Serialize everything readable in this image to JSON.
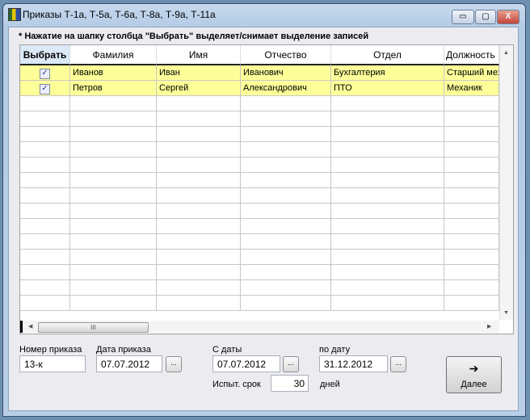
{
  "window": {
    "title": "Приказы Т-1а, Т-5а, Т-6а, Т-8а, Т-9а, Т-11а",
    "minimize": "▭",
    "maximize": "▢",
    "close": "X"
  },
  "hint": "* Нажатие на шапку столбца \"Выбрать\" выделяет/снимает выделение записей",
  "table": {
    "columns": [
      "Выбрать",
      "Фамилия",
      "Имя",
      "Отчество",
      "Отдел",
      "Должность"
    ],
    "rows": [
      {
        "selected": true,
        "check": "✓",
        "last": "Иванов",
        "first": "Иван",
        "middle": "Иванович",
        "dept": "Бухгалтерия",
        "position": "Старший механик"
      },
      {
        "selected": true,
        "check": "✓",
        "last": "Петров",
        "first": "Сергей",
        "middle": "Александрович",
        "dept": "ПТО",
        "position": "Механик"
      }
    ],
    "row_highlight": "#ffff99",
    "scroll_thumb": "III"
  },
  "form": {
    "order_number_label": "Номер приказа",
    "order_number": "13-к",
    "order_date_label": "Дата приказа",
    "order_date": "07.07.2012",
    "from_label": "С даты",
    "from_date": "07.07.2012",
    "to_label": "по дату",
    "to_date": "31.12.2012",
    "probation_label": "Испыт. срок",
    "probation": "30",
    "days_label": "дней",
    "picker": "..."
  },
  "next_button": {
    "label": "Далее",
    "icon": "arrow-right-icon",
    "glyph": "➔"
  }
}
